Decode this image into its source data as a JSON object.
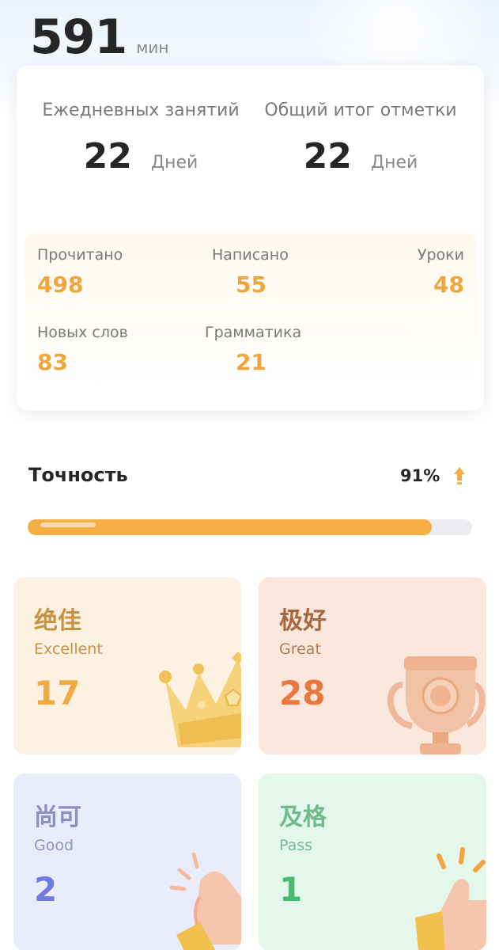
{
  "header": {
    "minutes_value": "591",
    "minutes_unit": "мин"
  },
  "summary": {
    "daily": {
      "label": "Ежедневных занятий",
      "value": "22",
      "unit": "Дней"
    },
    "total": {
      "label": "Общий итог отметки",
      "value": "22",
      "unit": "Дней"
    }
  },
  "details": {
    "read": {
      "label": "Прочитано",
      "value": "498"
    },
    "written": {
      "label": "Написано",
      "value": "55"
    },
    "lessons": {
      "label": "Уроки",
      "value": "48"
    },
    "new_words": {
      "label": "Новых слов",
      "value": "83"
    },
    "grammar": {
      "label": "Грамматика",
      "value": "21"
    }
  },
  "accuracy": {
    "title": "Точность",
    "percent_label": "91%",
    "percent": 91,
    "trend_icon": "arrow-up-icon"
  },
  "grades": {
    "excellent": {
      "cn": "绝佳",
      "en": "Excellent",
      "count": "17",
      "icon": "crown-icon"
    },
    "great": {
      "cn": "极好",
      "en": "Great",
      "count": "28",
      "icon": "trophy-icon"
    },
    "good": {
      "cn": "尚可",
      "en": "Good",
      "count": "2",
      "icon": "clapping-hands-icon"
    },
    "pass": {
      "cn": "及格",
      "en": "Pass",
      "count": "1",
      "icon": "thumbs-up-icon"
    }
  },
  "colors": {
    "accent_orange": "#f4ae45",
    "excellent_bg": "#fdf1e2",
    "great_bg": "#fce7dc",
    "good_bg": "#e8ecfb",
    "pass_bg": "#e3f7ea"
  }
}
